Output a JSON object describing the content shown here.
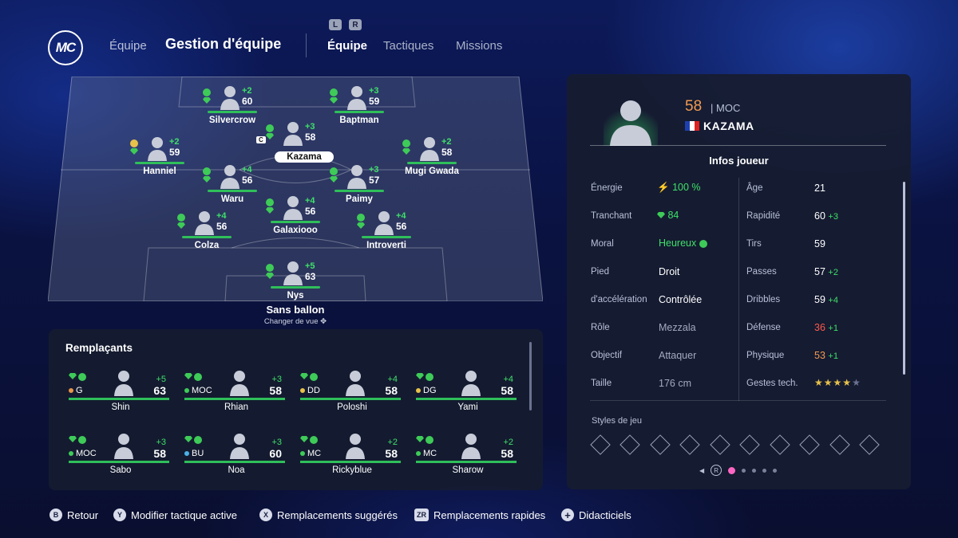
{
  "header": {
    "logo": "MC",
    "back_link": "Équipe",
    "title": "Gestion d'équipe",
    "bumper_left": "L",
    "bumper_right": "R",
    "tabs": [
      "Équipe",
      "Tactiques",
      "Missions"
    ]
  },
  "pitch": {
    "captain_badge": "C",
    "players": [
      {
        "name": "Silvercrow",
        "delta": "+2",
        "ovr": "60",
        "morale": "happy"
      },
      {
        "name": "Baptman",
        "delta": "+3",
        "ovr": "59",
        "morale": "happy"
      },
      {
        "name": "Kazama",
        "delta": "+3",
        "ovr": "58",
        "morale": "happy",
        "selected": true
      },
      {
        "name": "Hanniel",
        "delta": "+2",
        "ovr": "59",
        "morale": "content"
      },
      {
        "name": "Mugi Gwada",
        "delta": "+2",
        "ovr": "58",
        "morale": "happy"
      },
      {
        "name": "Waru",
        "delta": "+4",
        "ovr": "56",
        "morale": "happy"
      },
      {
        "name": "Paimy",
        "delta": "+3",
        "ovr": "57",
        "morale": "happy"
      },
      {
        "name": "Galaxiooo",
        "delta": "+4",
        "ovr": "56",
        "morale": "happy"
      },
      {
        "name": "Colza",
        "delta": "+4",
        "ovr": "56",
        "morale": "happy"
      },
      {
        "name": "Introverti",
        "delta": "+4",
        "ovr": "56",
        "morale": "happy"
      },
      {
        "name": "Nys",
        "delta": "+5",
        "ovr": "63",
        "morale": "happy"
      }
    ],
    "mode_label": "Sans ballon",
    "change_view_label": "Changer de vue"
  },
  "subs": {
    "title": "Remplaçants",
    "players": [
      {
        "name": "Shin",
        "pos": "G",
        "dot": "#e8944a",
        "delta": "+5",
        "ovr": "63"
      },
      {
        "name": "Rhian",
        "pos": "MOC",
        "dot": "#3ecb58",
        "delta": "+3",
        "ovr": "58"
      },
      {
        "name": "Poloshi",
        "pos": "DD",
        "dot": "#e7c14a",
        "delta": "+4",
        "ovr": "58"
      },
      {
        "name": "Yami",
        "pos": "DG",
        "dot": "#e7c14a",
        "delta": "+4",
        "ovr": "58"
      },
      {
        "name": "Sabo",
        "pos": "MOC",
        "dot": "#3ecb58",
        "delta": "+3",
        "ovr": "58"
      },
      {
        "name": "Noa",
        "pos": "BU",
        "dot": "#4ab2e8",
        "delta": "+3",
        "ovr": "60"
      },
      {
        "name": "Rickyblue",
        "pos": "MC",
        "dot": "#3ecb58",
        "delta": "+2",
        "ovr": "58"
      },
      {
        "name": "Sharow",
        "pos": "MC",
        "dot": "#3ecb58",
        "delta": "+2",
        "ovr": "58"
      }
    ]
  },
  "card": {
    "rating": "58",
    "position": "MOC",
    "name": "KAZAMA",
    "info_title": "Infos joueur",
    "left_attrs": [
      {
        "label": "Énergie",
        "value": "100 %"
      },
      {
        "label": "Tranchant",
        "value": "84"
      },
      {
        "label": "Moral",
        "value": "Heureux"
      },
      {
        "label": "Pied",
        "value": "Droit"
      },
      {
        "label": "d'accélération",
        "value": "Contrôlée"
      },
      {
        "label": "Rôle",
        "value": "Mezzala"
      },
      {
        "label": "Objectif",
        "value": "Attaquer"
      },
      {
        "label": "Taille",
        "value": "176 cm"
      }
    ],
    "right_attrs": [
      {
        "label": "Âge",
        "value": "21",
        "delta": ""
      },
      {
        "label": "Rapidité",
        "value": "60",
        "delta": "+3"
      },
      {
        "label": "Tirs",
        "value": "59",
        "delta": ""
      },
      {
        "label": "Passes",
        "value": "57",
        "delta": "+2"
      },
      {
        "label": "Dribbles",
        "value": "59",
        "delta": "+4"
      },
      {
        "label": "Défense",
        "value": "36",
        "delta": "+1"
      },
      {
        "label": "Physique",
        "value": "53",
        "delta": "+1"
      },
      {
        "label": "Gestes tech.",
        "value": "",
        "delta": ""
      }
    ],
    "skill_stars": 4,
    "skill_stars_max": 5,
    "styles_title": "Styles de jeu",
    "pager_button": "R",
    "pager_pages": 5,
    "pager_active": 1
  },
  "footer": [
    {
      "button": "B",
      "label": "Retour"
    },
    {
      "button": "Y",
      "label": "Modifier tactique active"
    },
    {
      "button": "X",
      "label": "Remplacements suggérés"
    },
    {
      "button": "ZR",
      "label": "Remplacements rapides"
    },
    {
      "button": "+",
      "label": "Didacticiels"
    }
  ],
  "colors": {
    "accent_green": "#3ee06a",
    "rating_orange": "#f29a50",
    "pager_pink": "#ff66c4"
  }
}
